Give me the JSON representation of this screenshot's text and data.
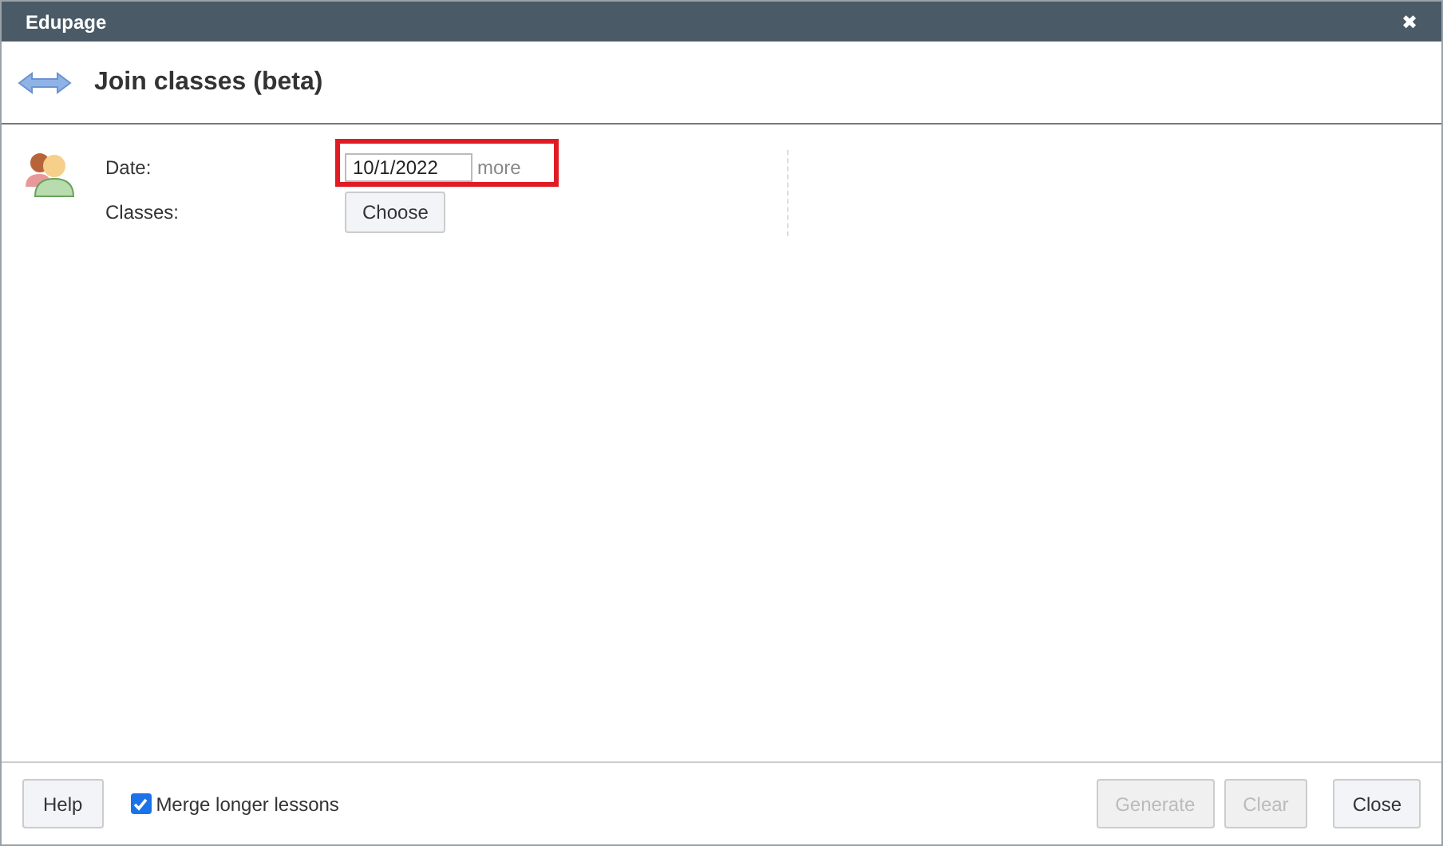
{
  "window": {
    "title": "Edupage",
    "close": "✖"
  },
  "header": {
    "title": "Join classes (beta)"
  },
  "form": {
    "date_label": "Date:",
    "date_value": "10/1/2022",
    "more": "more",
    "highlighted": true,
    "classes_label": "Classes:",
    "choose": "Choose"
  },
  "footer": {
    "help": "Help",
    "merge": {
      "label": "Merge longer lessons",
      "checked": true
    },
    "buttons": [
      {
        "label": "Generate",
        "disabled": true
      },
      {
        "label": "Clear",
        "disabled": true
      },
      {
        "label": "Close",
        "disabled": false
      }
    ]
  }
}
